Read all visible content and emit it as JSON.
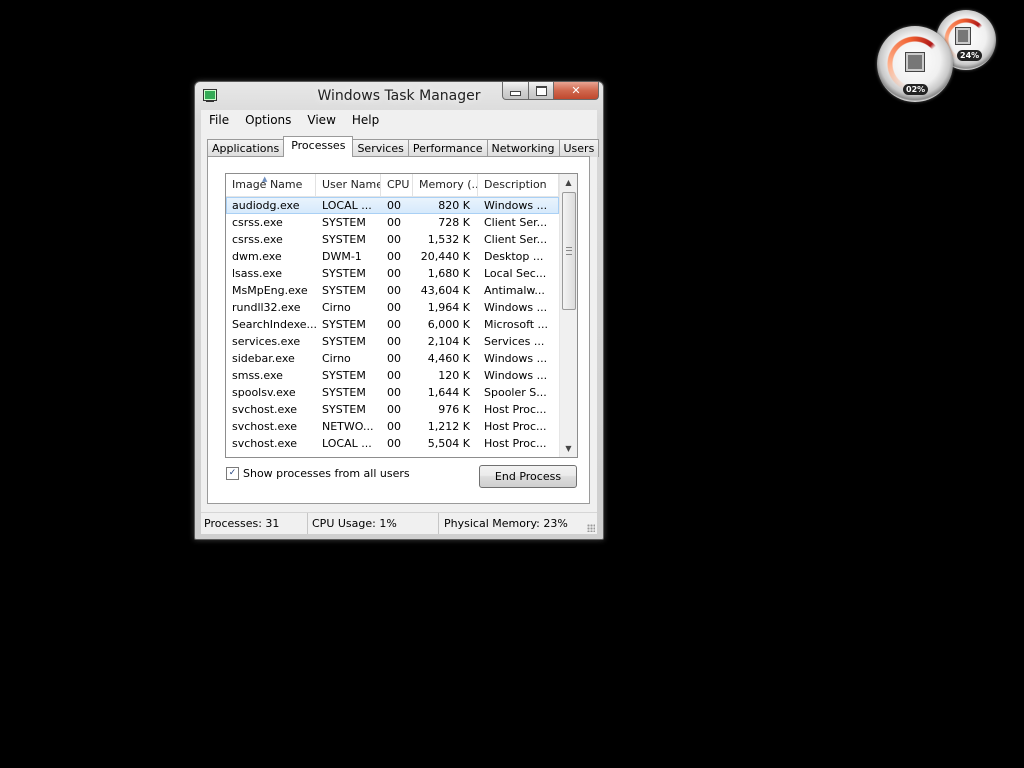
{
  "desktop": {
    "gadget": {
      "cpu_value": "02%",
      "memory_value": "24%"
    }
  },
  "window": {
    "title": "Windows Task Manager",
    "caption": {
      "minimize": "",
      "maximize": "",
      "close": "✕"
    }
  },
  "menu": [
    "File",
    "Options",
    "View",
    "Help"
  ],
  "tabs": [
    {
      "label": "Applications",
      "active": false
    },
    {
      "label": "Processes",
      "active": true
    },
    {
      "label": "Services",
      "active": false
    },
    {
      "label": "Performance",
      "active": false
    },
    {
      "label": "Networking",
      "active": false
    },
    {
      "label": "Users",
      "active": false
    }
  ],
  "processes": {
    "columns": [
      "Image Name",
      "User Name",
      "CPU",
      "Memory (...",
      "Description"
    ],
    "sorted_by": "Image Name",
    "sort_direction": "ascending",
    "rows": [
      [
        "audiodg.exe",
        "LOCAL ...",
        "00",
        "820 K",
        "Windows ..."
      ],
      [
        "csrss.exe",
        "SYSTEM",
        "00",
        "728 K",
        "Client Ser..."
      ],
      [
        "csrss.exe",
        "SYSTEM",
        "00",
        "1,532 K",
        "Client Ser..."
      ],
      [
        "dwm.exe",
        "DWM-1",
        "00",
        "20,440 K",
        "Desktop ..."
      ],
      [
        "lsass.exe",
        "SYSTEM",
        "00",
        "1,680 K",
        "Local Sec..."
      ],
      [
        "MsMpEng.exe",
        "SYSTEM",
        "00",
        "43,604 K",
        "Antimalw..."
      ],
      [
        "rundll32.exe",
        "Cirno",
        "00",
        "1,964 K",
        "Windows ..."
      ],
      [
        "SearchIndexe...",
        "SYSTEM",
        "00",
        "6,000 K",
        "Microsoft ..."
      ],
      [
        "services.exe",
        "SYSTEM",
        "00",
        "2,104 K",
        "Services ..."
      ],
      [
        "sidebar.exe",
        "Cirno",
        "00",
        "4,460 K",
        "Windows ..."
      ],
      [
        "smss.exe",
        "SYSTEM",
        "00",
        "120 K",
        "Windows ..."
      ],
      [
        "spoolsv.exe",
        "SYSTEM",
        "00",
        "1,644 K",
        "Spooler S..."
      ],
      [
        "svchost.exe",
        "SYSTEM",
        "00",
        "976 K",
        "Host Proc..."
      ],
      [
        "svchost.exe",
        "NETWO...",
        "00",
        "1,212 K",
        "Host Proc..."
      ],
      [
        "svchost.exe",
        "LOCAL ...",
        "00",
        "5,504 K",
        "Host Proc..."
      ]
    ],
    "selected_row": 0,
    "show_all_users_label": "Show processes from all users",
    "show_all_users_checked": true,
    "end_process_label": "End Process"
  },
  "status": {
    "processes": "Processes: 31",
    "cpu": "CPU Usage: 1%",
    "memory": "Physical Memory: 23%"
  },
  "colors": {
    "desktop": "#000000",
    "selection": "#d5e9fb",
    "close_button": "#c8583e"
  }
}
